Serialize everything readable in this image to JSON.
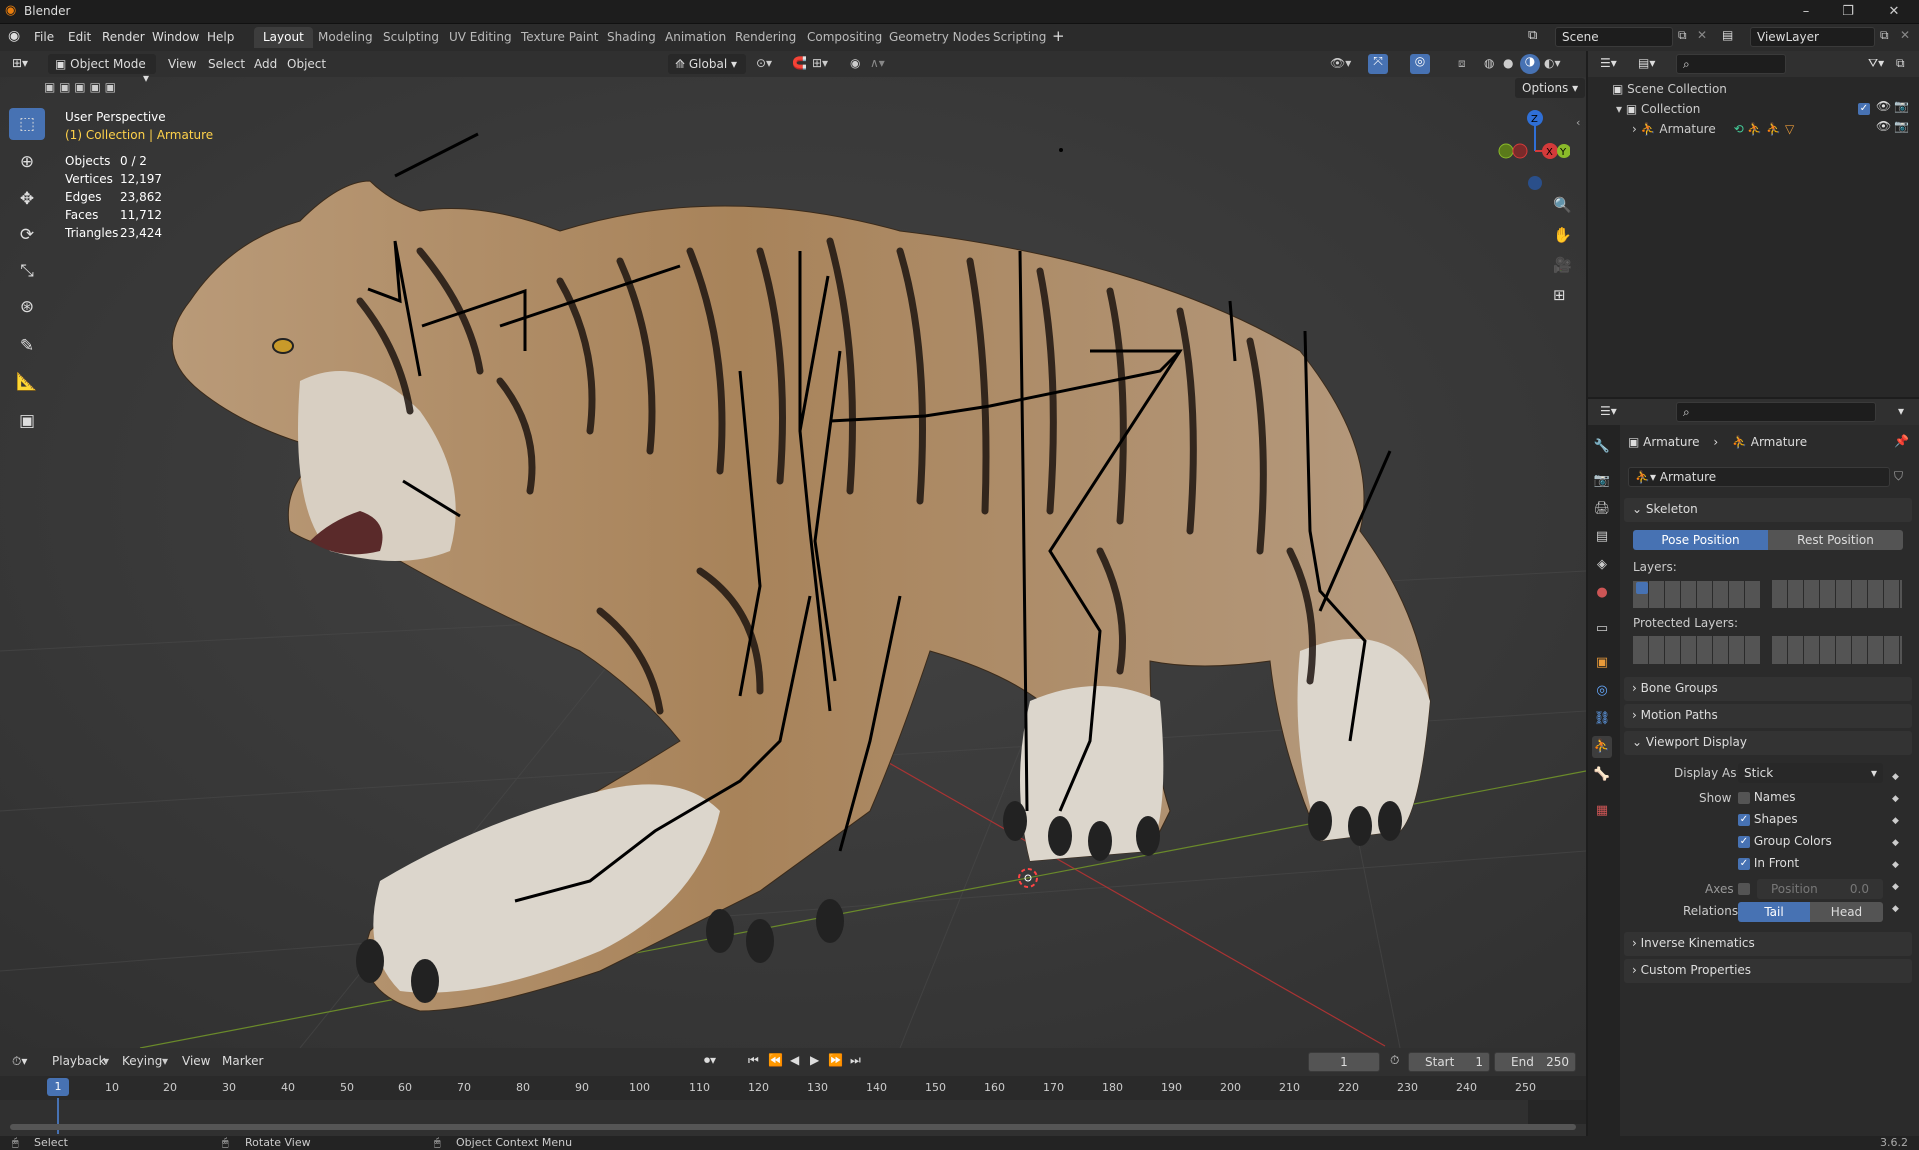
{
  "app": {
    "title": "Blender",
    "version": "3.6.2"
  },
  "menus": [
    "File",
    "Edit",
    "Render",
    "Window",
    "Help"
  ],
  "workspaces": [
    "Layout",
    "Modeling",
    "Sculpting",
    "UV Editing",
    "Texture Paint",
    "Shading",
    "Animation",
    "Rendering",
    "Compositing",
    "Geometry Nodes",
    "Scripting"
  ],
  "active_workspace": "Layout",
  "scene": {
    "name": "Scene",
    "view_layer": "ViewLayer"
  },
  "viewport": {
    "mode": "Object Mode",
    "menus": [
      "View",
      "Select",
      "Add",
      "Object"
    ],
    "transform_orientation": "Global",
    "options_label": "Options",
    "perspective": "User Perspective",
    "collection_text": "(1) Collection | Armature",
    "stats": [
      {
        "label": "Objects",
        "value": "0 / 2"
      },
      {
        "label": "Vertices",
        "value": "12,197"
      },
      {
        "label": "Edges",
        "value": "23,862"
      },
      {
        "label": "Faces",
        "value": "11,712"
      },
      {
        "label": "Triangles",
        "value": "23,424"
      }
    ],
    "gizmo": {
      "z": "Z",
      "x": "X",
      "y": "Y"
    }
  },
  "outliner": {
    "scene_collection": "Scene Collection",
    "collection": "Collection",
    "armature": "Armature"
  },
  "properties": {
    "breadcrumb_object": "Armature",
    "breadcrumb_data": "Armature",
    "data_name": "Armature",
    "skeleton": "Skeleton",
    "pose_position": "Pose Position",
    "rest_position": "Rest Position",
    "layers": "Layers:",
    "protected_layers": "Protected Layers:",
    "bone_groups": "Bone Groups",
    "motion_paths": "Motion Paths",
    "viewport_display": "Viewport Display",
    "display_as_label": "Display As",
    "display_as": "Stick",
    "show_label": "Show",
    "show_names": "Names",
    "show_names_checked": false,
    "show_shapes": "Shapes",
    "show_shapes_checked": true,
    "show_group_colors": "Group Colors",
    "show_group_colors_checked": true,
    "show_in_front": "In Front",
    "show_in_front_checked": true,
    "axes_label": "Axes",
    "axes_position_label": "Position",
    "axes_position_value": "0.0",
    "relations_label": "Relations",
    "relations_tail": "Tail",
    "relations_head": "Head",
    "inverse_kinematics": "Inverse Kinematics",
    "custom_properties": "Custom Properties"
  },
  "timeline": {
    "menus": [
      "Playback",
      "Keying",
      "View",
      "Marker"
    ],
    "current_frame": "1",
    "start_label": "Start",
    "start": "1",
    "end_label": "End",
    "end": "250",
    "ticks": [
      "1",
      "10",
      "20",
      "30",
      "40",
      "50",
      "60",
      "70",
      "80",
      "90",
      "100",
      "110",
      "120",
      "130",
      "140",
      "150",
      "160",
      "170",
      "180",
      "190",
      "200",
      "210",
      "220",
      "230",
      "240",
      "250"
    ]
  },
  "status": {
    "select": "Select",
    "rotate": "Rotate View",
    "context": "Object Context Menu"
  }
}
